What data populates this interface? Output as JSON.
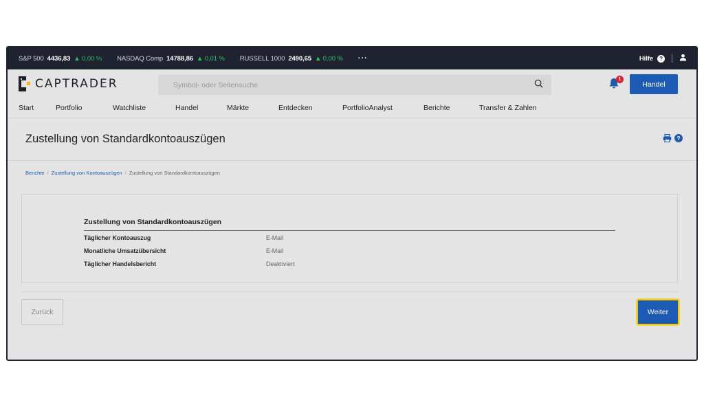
{
  "ticker": {
    "items": [
      {
        "name": "S&P 500",
        "value": "4436,83",
        "change": "▲ 0,00 %"
      },
      {
        "name": "NASDAQ Comp",
        "value": "14788,86",
        "change": "▲ 0,01 %"
      },
      {
        "name": "RUSSELL 1000",
        "value": "2490,65",
        "change": "▲ 0,00 %"
      }
    ],
    "more": "···",
    "help": "Hilfe",
    "help_icon": "question-circle-icon",
    "user_icon": "user-icon"
  },
  "header": {
    "logo_text": "CAPTRADER",
    "search_placeholder": "Symbol- oder Seitensuche",
    "notification_count": "1",
    "trade_button": "Handel"
  },
  "nav": {
    "items": [
      "Start",
      "Portfolio",
      "Watchliste",
      "Handel",
      "Märkte",
      "Entdecken",
      "PortfolioAnalyst",
      "Berichte",
      "Transfer & Zahlen"
    ]
  },
  "page": {
    "title": "Zustellung von Standardkontoauszügen",
    "breadcrumb": [
      "Berichte",
      "Zustellung von Kontoauszügen",
      "Zustellung von Standardkontoauszügen"
    ]
  },
  "panel": {
    "heading": "Zustellung von Standardkontoauszügen",
    "rows": [
      {
        "label": "Täglicher Kontoauszug",
        "value": "E-Mail"
      },
      {
        "label": "Monatliche Umsatzübersicht",
        "value": "E-Mail"
      },
      {
        "label": "Täglicher Handelsbericht",
        "value": "Deaktiviert"
      }
    ]
  },
  "buttons": {
    "back": "Zurück",
    "next": "Weiter"
  },
  "colors": {
    "primary": "#1c5ab3",
    "ticker_bg": "#1f2231",
    "up": "#2fbf5f",
    "badge": "#d6232c",
    "focus": "#f0c419"
  }
}
